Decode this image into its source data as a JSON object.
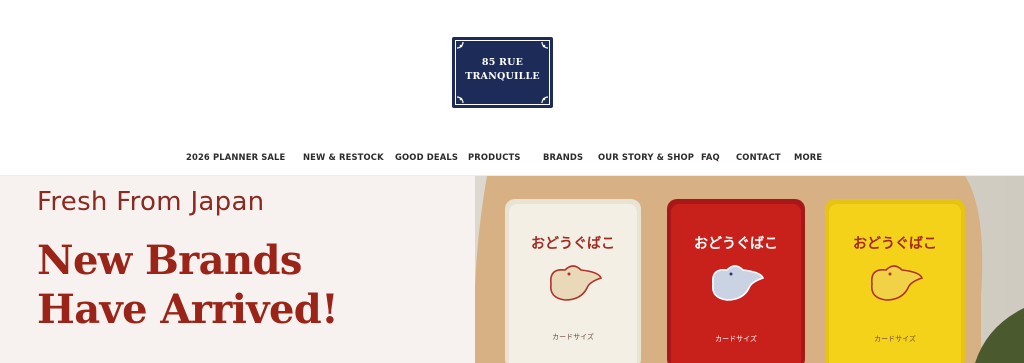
{
  "logo": {
    "line1": "85 RUE",
    "line2": "TRANQUILLE",
    "bg_color": "#1c2b57"
  },
  "nav": {
    "items": [
      {
        "label": "2026 PLANNER SALE"
      },
      {
        "label": "NEW & RESTOCK"
      },
      {
        "label": "GOOD DEALS"
      },
      {
        "label": "PRODUCTS"
      },
      {
        "label": "BRANDS"
      },
      {
        "label": "OUR STORY & SHOP"
      },
      {
        "label": "FAQ"
      },
      {
        "label": "CONTACT"
      },
      {
        "label": "MORE"
      }
    ]
  },
  "hero": {
    "subtitle": "Fresh From Japan",
    "title_line1": "New Brands",
    "title_line2": "Have Arrived!",
    "bg_color": "#f7f1ef",
    "accent_color": "#9a2418",
    "products": [
      {
        "name": "おどうぐばこ",
        "size_label": "カードサイズ",
        "color": "#f3efe4"
      },
      {
        "name": "おどうぐばこ",
        "size_label": "カードサイズ",
        "color": "#c8211c"
      },
      {
        "name": "おどうぐばこ",
        "size_label": "カードサイズ",
        "color": "#f4d21a"
      }
    ]
  }
}
